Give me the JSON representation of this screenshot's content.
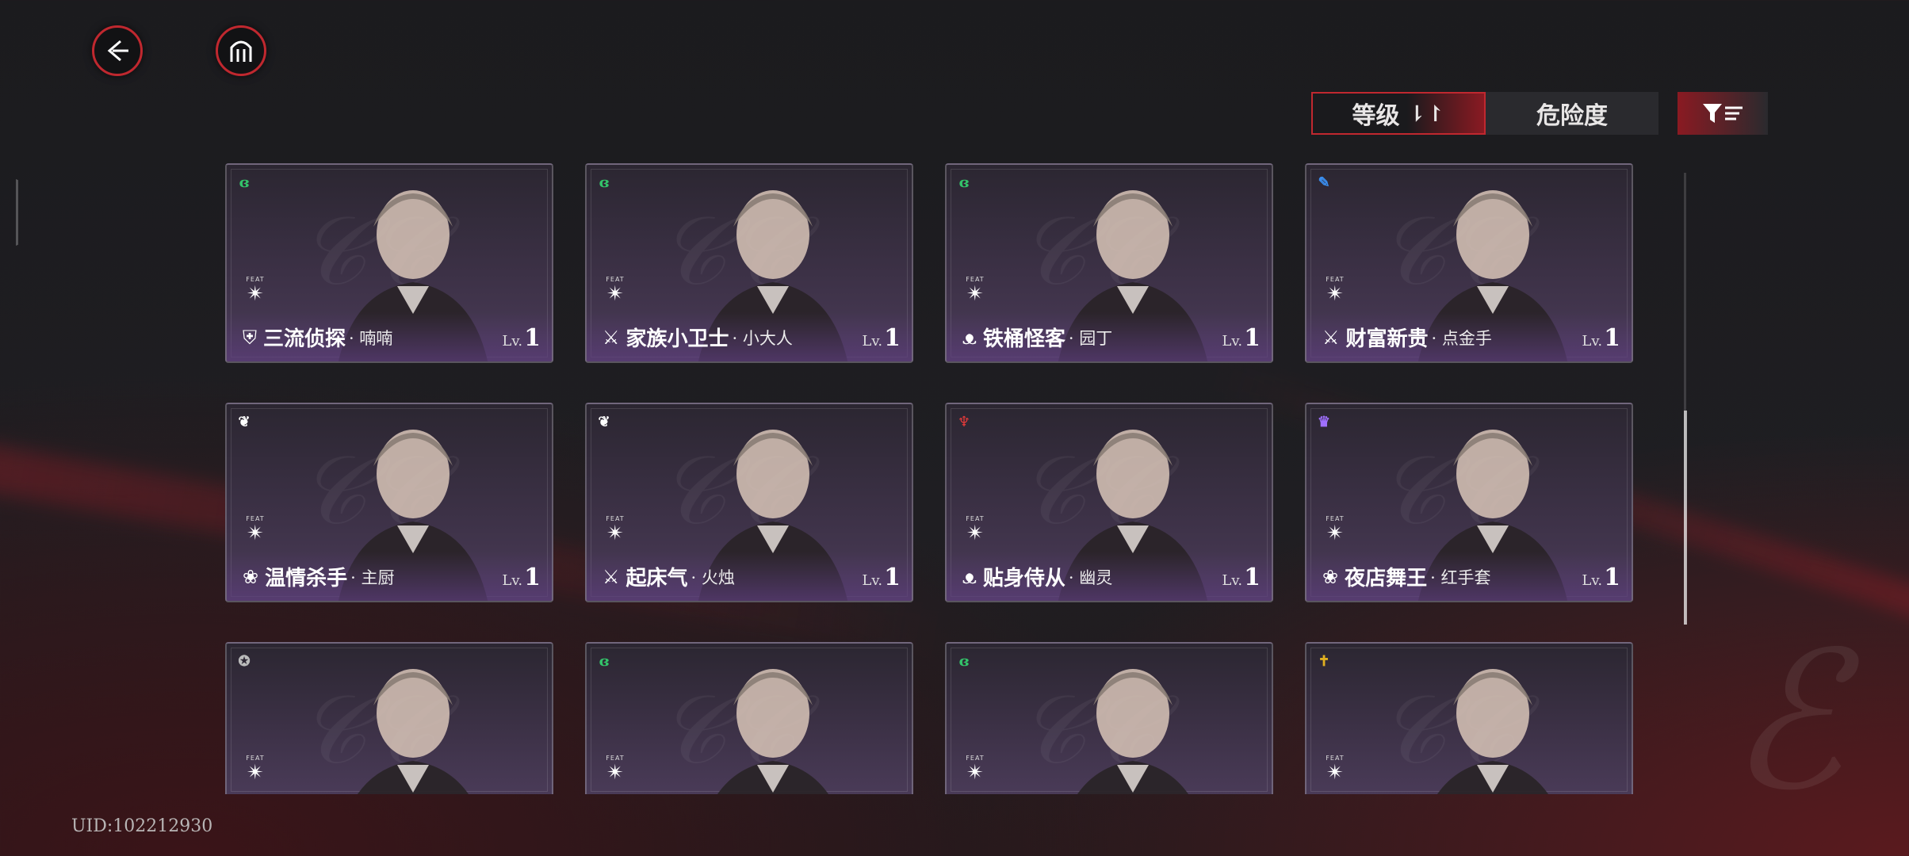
{
  "uid": "UID:102212930",
  "sort": {
    "level_label": "等级",
    "level_arrow": "⇂↾",
    "danger_label": "危险度"
  },
  "feat_label": "FEAT",
  "level_prefix": "Lv.",
  "colors": {
    "accent": "#c0282f",
    "card_purple": "#4a3b58"
  },
  "cards": [
    {
      "faction_icon": "green-swirl-icon",
      "faction_color": "#33c46a",
      "role_icon": "shield-icon",
      "name": "三流侦探",
      "title": "· 喃喃",
      "level": "1"
    },
    {
      "faction_icon": "green-swirl-icon",
      "faction_color": "#33c46a",
      "role_icon": "crossed-swords-icon",
      "name": "家族小卫士",
      "title": "· 小大人",
      "level": "1"
    },
    {
      "faction_icon": "green-swirl-icon",
      "faction_color": "#33c46a",
      "role_icon": "wings-icon",
      "name": "铁桶怪客",
      "title": "· 园丁",
      "level": "1"
    },
    {
      "faction_icon": "blue-pin-icon",
      "faction_color": "#3a8ef0",
      "role_icon": "crossed-swords-icon",
      "name": "财富新贵",
      "title": "· 点金手",
      "level": "1"
    },
    {
      "faction_icon": "white-butterfly-icon",
      "faction_color": "#ffffff",
      "role_icon": "lotus-icon",
      "name": "温情杀手",
      "title": "· 主厨",
      "level": "1"
    },
    {
      "faction_icon": "white-butterfly-icon",
      "faction_color": "#ffffff",
      "role_icon": "crossed-swords-icon",
      "name": "起床气",
      "title": "· 火烛",
      "level": "1"
    },
    {
      "faction_icon": "red-goblet-icon",
      "faction_color": "#e23a3a",
      "role_icon": "wings-icon",
      "name": "贴身侍从",
      "title": "· 幽灵",
      "level": "1"
    },
    {
      "faction_icon": "purple-crown-icon",
      "faction_color": "#a070ff",
      "role_icon": "lotus-icon",
      "name": "夜店舞王",
      "title": "· 红手套",
      "level": "1"
    },
    {
      "faction_icon": "grey-emblem-icon",
      "faction_color": "#bbbbbb"
    },
    {
      "faction_icon": "green-swirl-icon",
      "faction_color": "#33c46a"
    },
    {
      "faction_icon": "green-swirl-icon",
      "faction_color": "#33c46a"
    },
    {
      "faction_icon": "gold-sword-icon",
      "faction_color": "#e0b020"
    }
  ]
}
